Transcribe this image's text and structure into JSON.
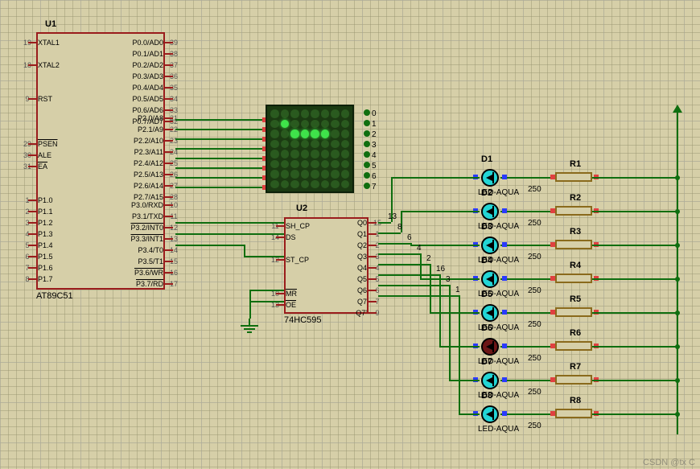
{
  "u1": {
    "ref": "U1",
    "part": "AT89C51",
    "left_pins": [
      {
        "name": "XTAL1",
        "num": "19"
      },
      {
        "name": "",
        "num": ""
      },
      {
        "name": "XTAL2",
        "num": "18"
      },
      {
        "name": "",
        "num": ""
      },
      {
        "name": "",
        "num": ""
      },
      {
        "name": "RST",
        "num": "9"
      },
      {
        "name": "",
        "num": ""
      },
      {
        "name": "",
        "num": ""
      },
      {
        "name": "",
        "num": ""
      },
      {
        "name": "PSEN",
        "num": "29",
        "over": true
      },
      {
        "name": "ALE",
        "num": "30"
      },
      {
        "name": "EA",
        "num": "31",
        "over": true
      },
      {
        "name": "",
        "num": ""
      },
      {
        "name": "",
        "num": ""
      },
      {
        "name": "P1.0",
        "num": "1"
      },
      {
        "name": "P1.1",
        "num": "2"
      },
      {
        "name": "P1.2",
        "num": "3"
      },
      {
        "name": "P1.3",
        "num": "4"
      },
      {
        "name": "P1.4",
        "num": "5"
      },
      {
        "name": "P1.5",
        "num": "6"
      },
      {
        "name": "P1.6",
        "num": "7"
      },
      {
        "name": "P1.7",
        "num": "8"
      }
    ],
    "right_pins_top": [
      {
        "name": "P0.0/AD0",
        "num": "39"
      },
      {
        "name": "P0.1/AD1",
        "num": "38"
      },
      {
        "name": "P0.2/AD2",
        "num": "37"
      },
      {
        "name": "P0.3/AD3",
        "num": "36"
      },
      {
        "name": "P0.4/AD4",
        "num": "35"
      },
      {
        "name": "P0.5/AD5",
        "num": "34"
      },
      {
        "name": "P0.6/AD6",
        "num": "33"
      },
      {
        "name": "P0.7/AD7",
        "num": "32"
      }
    ],
    "right_pins_p2": [
      {
        "name": "P2.0/A8",
        "num": "21"
      },
      {
        "name": "P2.1/A9",
        "num": "22"
      },
      {
        "name": "P2.2/A10",
        "num": "23"
      },
      {
        "name": "P2.3/A11",
        "num": "24"
      },
      {
        "name": "P2.4/A12",
        "num": "25"
      },
      {
        "name": "P2.5/A13",
        "num": "26"
      },
      {
        "name": "P2.6/A14",
        "num": "27"
      },
      {
        "name": "P2.7/A15",
        "num": "28"
      }
    ],
    "right_pins_p3": [
      {
        "name": "P3.0/RXD",
        "num": "10"
      },
      {
        "name": "P3.1/TXD",
        "num": "11"
      },
      {
        "name": "P3.2/INT0",
        "num": "12",
        "over": true
      },
      {
        "name": "P3.3/INT1",
        "num": "13",
        "over": true
      },
      {
        "name": "P3.4/T0",
        "num": "14"
      },
      {
        "name": "P3.5/T1",
        "num": "15"
      },
      {
        "name": "P3.6/WR",
        "num": "16",
        "over": true
      },
      {
        "name": "P3.7/RD",
        "num": "17",
        "over": true
      }
    ]
  },
  "matrix_labels": [
    "0",
    "1",
    "2",
    "3",
    "4",
    "5",
    "6",
    "7"
  ],
  "u2": {
    "ref": "U2",
    "part": "74HC595",
    "left_pins": [
      {
        "name": "SH_CP",
        "num": "11"
      },
      {
        "name": "DS",
        "num": "14"
      },
      {
        "name": "",
        "num": ""
      },
      {
        "name": "ST_CP",
        "num": "12"
      },
      {
        "name": "",
        "num": ""
      },
      {
        "name": "",
        "num": ""
      },
      {
        "name": "MR",
        "num": "10",
        "over": true
      },
      {
        "name": "OE",
        "num": "13",
        "over": true
      }
    ],
    "right_pins": [
      {
        "name": "Q0",
        "num": "15"
      },
      {
        "name": "Q1",
        "num": "1"
      },
      {
        "name": "Q2",
        "num": "2"
      },
      {
        "name": "Q3",
        "num": "3"
      },
      {
        "name": "Q4",
        "num": "4"
      },
      {
        "name": "Q5",
        "num": "5"
      },
      {
        "name": "Q6",
        "num": "6"
      },
      {
        "name": "Q7",
        "num": "7"
      },
      {
        "name": "Q7'",
        "num": "9"
      }
    ]
  },
  "leds": [
    {
      "ref": "D1",
      "part": "LED-AQUA",
      "on": true
    },
    {
      "ref": "D2",
      "part": "LED-AQUA",
      "on": true
    },
    {
      "ref": "D3",
      "part": "LED-AQUA",
      "on": true
    },
    {
      "ref": "D4",
      "part": "LED-AQUA",
      "on": true
    },
    {
      "ref": "D5",
      "part": "LED-AQUA",
      "on": true
    },
    {
      "ref": "D6",
      "part": "LED-AQUA",
      "on": false
    },
    {
      "ref": "D7",
      "part": "LED-AQUA",
      "on": true
    },
    {
      "ref": "D8",
      "part": "LED-AQUA",
      "on": true
    }
  ],
  "resistors": [
    {
      "ref": "R1",
      "value": "250"
    },
    {
      "ref": "R2",
      "value": "250"
    },
    {
      "ref": "R3",
      "value": "250"
    },
    {
      "ref": "R4",
      "value": "250"
    },
    {
      "ref": "R5",
      "value": "250"
    },
    {
      "ref": "R6",
      "value": "250"
    },
    {
      "ref": "R7",
      "value": "250"
    },
    {
      "ref": "R8",
      "value": "250"
    }
  ],
  "led_q_labels": [
    "13",
    "8",
    "6",
    "4",
    "2",
    "16",
    "3",
    "1"
  ],
  "watermark": "CSDN @tx C"
}
